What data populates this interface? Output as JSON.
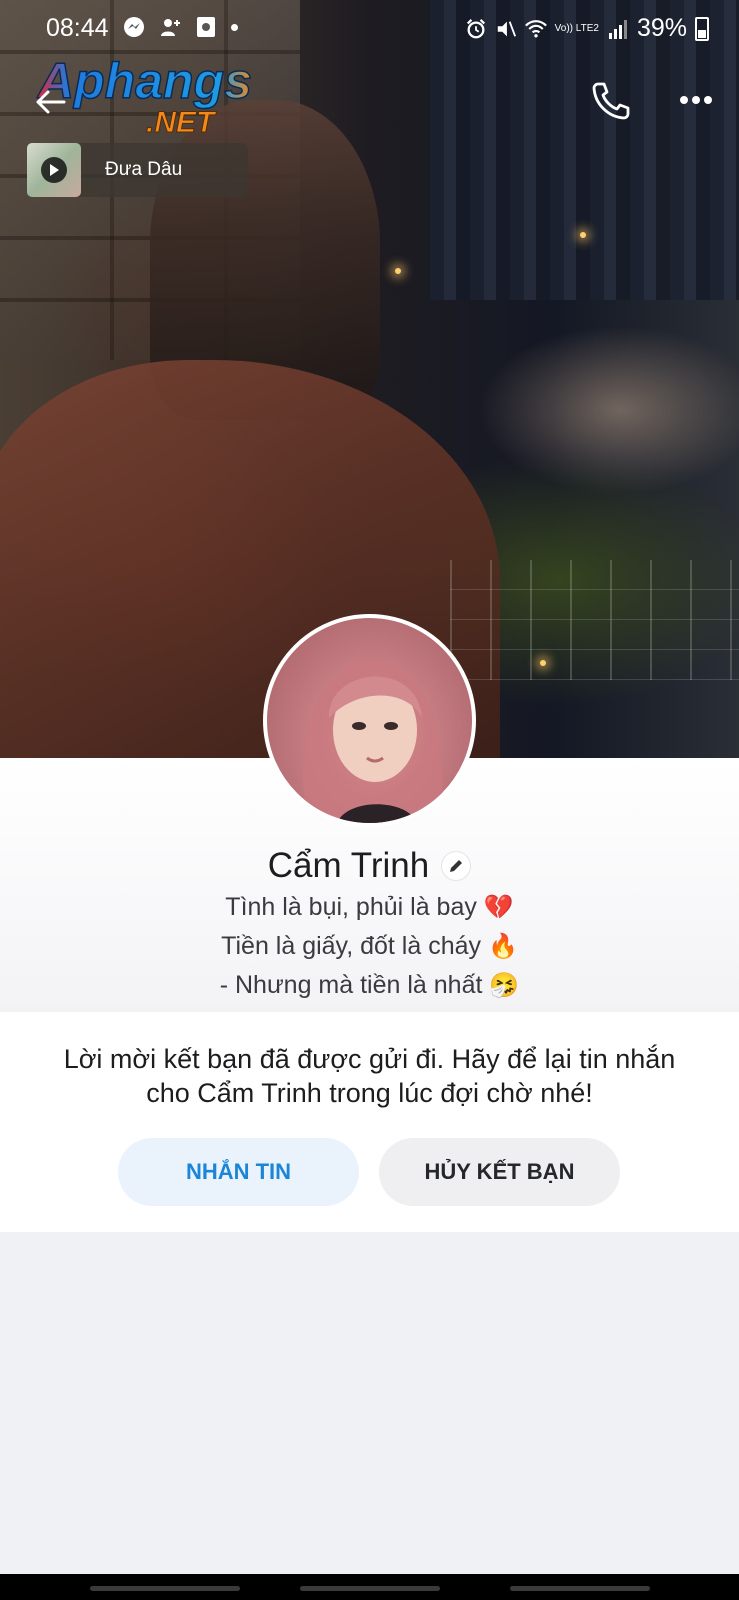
{
  "status_bar": {
    "time": "08:44",
    "network_label": "Vo)) LTE2",
    "battery_percent": "39%"
  },
  "watermark": {
    "line1": "Aphangs",
    "line2": ".NET"
  },
  "music": {
    "title": "Đưa Dâu"
  },
  "profile": {
    "name": "Cẩm Trinh",
    "bio_lines": [
      {
        "text": "Tình là bụi, phủi là bay",
        "emoji": "💔"
      },
      {
        "text": "Tiền là giấy, đốt là cháy",
        "emoji": "🔥"
      },
      {
        "text": "- Nhưng mà tiền là nhất",
        "emoji": "🤧"
      }
    ]
  },
  "friend_request": {
    "message": "Lời mời kết bạn đã được gửi đi. Hãy để lại tin nhắn cho Cẩm Trinh trong lúc đợi chờ nhé!",
    "message_button": "NHẮN TIN",
    "unfriend_button": "HỦY KẾT BẠN"
  },
  "colors": {
    "accent_blue": "#1b86d8",
    "message_button_bg": "#eaf3fb",
    "unfriend_button_bg": "#efeff2"
  },
  "icons": {
    "back": "arrow-left-icon",
    "call": "phone-icon",
    "more": "more-dots-icon",
    "edit": "pencil-icon",
    "play": "play-icon"
  }
}
